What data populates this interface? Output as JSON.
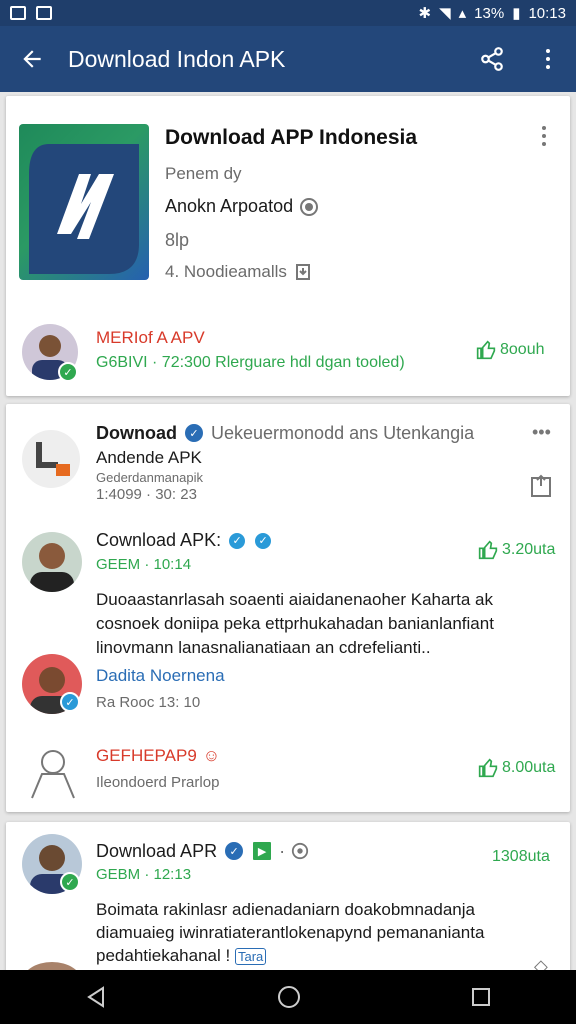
{
  "status_bar": {
    "battery_pct": "13%",
    "time": "10:13"
  },
  "app_bar": {
    "title": "Download Indon APK"
  },
  "app_card": {
    "name": "Download APP Indonesia",
    "developer": "Penem dy",
    "publisher": "Anokn Arpoatod",
    "size": "8lp",
    "downloads": "4. Noodieamalls",
    "review": {
      "author": "MERIof A APV",
      "meta": "G6BIVI · 72:300 Rlerguare hdl dgan tooled)",
      "likes": "8oouh"
    }
  },
  "post_card": {
    "title": "Downoad",
    "subtitle": "Uekeuermonodd ans Utenkangia",
    "line2": "Andende APK",
    "line3": "Gederdanmanapik",
    "time": "1:4099 · 30: 23",
    "comments": [
      {
        "author": "Cownload APK:",
        "meta": "GEEM · 10:14",
        "likes": "3.20uta",
        "text": "Duoaastanrlasah soaenti aiaidanenaoher Kaharta ak cosnoek doniipa peka ettprhukahadan banianlanfiant linovmann lanasnalianatiaan an cdrefelianti..",
        "link": "Dadita Noernena"
      },
      {
        "author": "",
        "meta": "Ra Rooc 13: 10",
        "likes": ""
      },
      {
        "author": "GEFHEPAP9",
        "meta": "Ileondoerd Prarlop",
        "likes": "8.00uta"
      }
    ]
  },
  "third_card": {
    "author": "Download APR",
    "meta": "GEBM · 12:13",
    "likes": "1308uta",
    "text": "Boimata rakinlasr adienadaniarn doakobmnadanja diamuaieg iwinratiaterantlokenapynd pemananianta pedahtiekahanal !",
    "tag": "Tara"
  },
  "colors": {
    "appbar": "#23477a",
    "statusbar": "#1f3e6b",
    "green": "#2fa84f",
    "red": "#d83a2a",
    "link": "#2a6db5"
  },
  "icons": [
    "back-arrow-icon",
    "share-icon",
    "more-vert-icon",
    "verified-icon",
    "thumbs-up-icon",
    "download-icon",
    "home-icon",
    "recents-icon"
  ]
}
